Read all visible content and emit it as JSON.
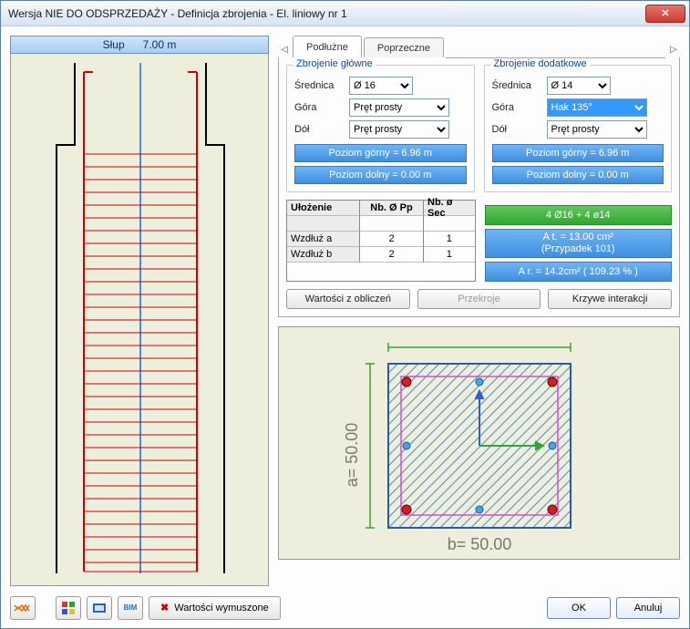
{
  "window": {
    "title": "Wersja NIE DO ODSPRZEDAŻY - Definicja zbrojenia - El. liniowy nr 1"
  },
  "beam": {
    "type_label": "Słup",
    "length_label": "7.00 m"
  },
  "tabs": {
    "t1": "Podłużne",
    "t2": "Poprzeczne"
  },
  "main_reinf": {
    "legend": "Zbrojenie główne",
    "diameter_label": "Średnica",
    "diameter_value": "Ø 16",
    "top_label": "Góra",
    "top_value": "Pręt prosty",
    "bottom_label": "Dół",
    "bottom_value": "Pręt prosty",
    "level_top": "Poziom górny =  6.96 m",
    "level_bot": "Poziom dolny =  0.00 m"
  },
  "add_reinf": {
    "legend": "Zbrojenie dodatkowe",
    "diameter_label": "Średnica",
    "diameter_value": "Ø 14",
    "top_label": "Góra",
    "top_value": "Hak 135°",
    "bottom_label": "Dół",
    "bottom_value": "Pręt prosty",
    "level_top": "Poziom górny =  6.96 m",
    "level_bot": "Poziom dolny =  0.00 m"
  },
  "table": {
    "h1": "Ułożenie",
    "h2": "Nb. Ø Pp",
    "h3": "Nb. ø Sec",
    "rows": [
      {
        "c1": "Wzdłuż  a",
        "c2": "2",
        "c3": "1"
      },
      {
        "c1": "Wzdłuż  b",
        "c2": "2",
        "c3": "1"
      }
    ]
  },
  "summary": {
    "green": "4 Ø16 + 4 ø14",
    "at_line1": "A t. = 13.00 cm²",
    "at_line2": "(Przypadek 101)",
    "ar": "A r. = 14.2cm² ( 109.23 % )"
  },
  "buttons": {
    "calc_values": "Wartości z obliczeń",
    "sections": "Przekroje",
    "interaction": "Krzywe interakcji",
    "forced": "Wartości wymuszone",
    "ok": "OK",
    "cancel": "Anuluj"
  },
  "section": {
    "a_label": "a= 50.00",
    "b_label": "b= 50.00"
  },
  "icons": {
    "bim": "BIM"
  }
}
